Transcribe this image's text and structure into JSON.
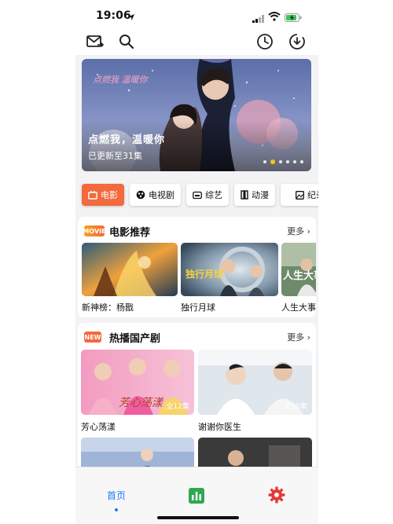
{
  "status": {
    "time": "19:06"
  },
  "banner": {
    "title": "点燃我，温暖你",
    "subtitle": "已更新至31集",
    "logo_text": "点燃我 温暖你",
    "slide_count": 6,
    "active_slide": 2
  },
  "categories": [
    {
      "label": "电影",
      "icon": "film-icon",
      "active": true
    },
    {
      "label": "电视剧",
      "icon": "tv-icon",
      "active": false
    },
    {
      "label": "综艺",
      "icon": "variety-icon",
      "active": false
    },
    {
      "label": "动漫",
      "icon": "anime-icon",
      "active": false
    },
    {
      "label": "纪录片",
      "icon": "documentary-icon",
      "active": false
    }
  ],
  "movie_section": {
    "badge": "MOVIE",
    "title": "电影推荐",
    "more": "更多 ›",
    "items": [
      {
        "title": "新神榜：杨戬",
        "poster_text": ""
      },
      {
        "title": "独行月球",
        "poster_text": "独行月球"
      },
      {
        "title": "人生大事",
        "poster_text": "人生大事"
      }
    ]
  },
  "drama_section": {
    "badge": "NEW",
    "title": "热播国产剧",
    "more": "更多 ›",
    "items": [
      {
        "title": "芳心荡漾",
        "episodes": "全12集",
        "poster_text": "芳心荡漾"
      },
      {
        "title": "谢谢你医生",
        "episodes": "全30集",
        "poster_text": ""
      }
    ]
  },
  "tabbar": {
    "home_label": "首页"
  },
  "colors": {
    "accent": "#f26a3d",
    "tab_active": "#1e78ff",
    "chart_tab": "#2fa84f",
    "settings_tab": "#e53935"
  }
}
